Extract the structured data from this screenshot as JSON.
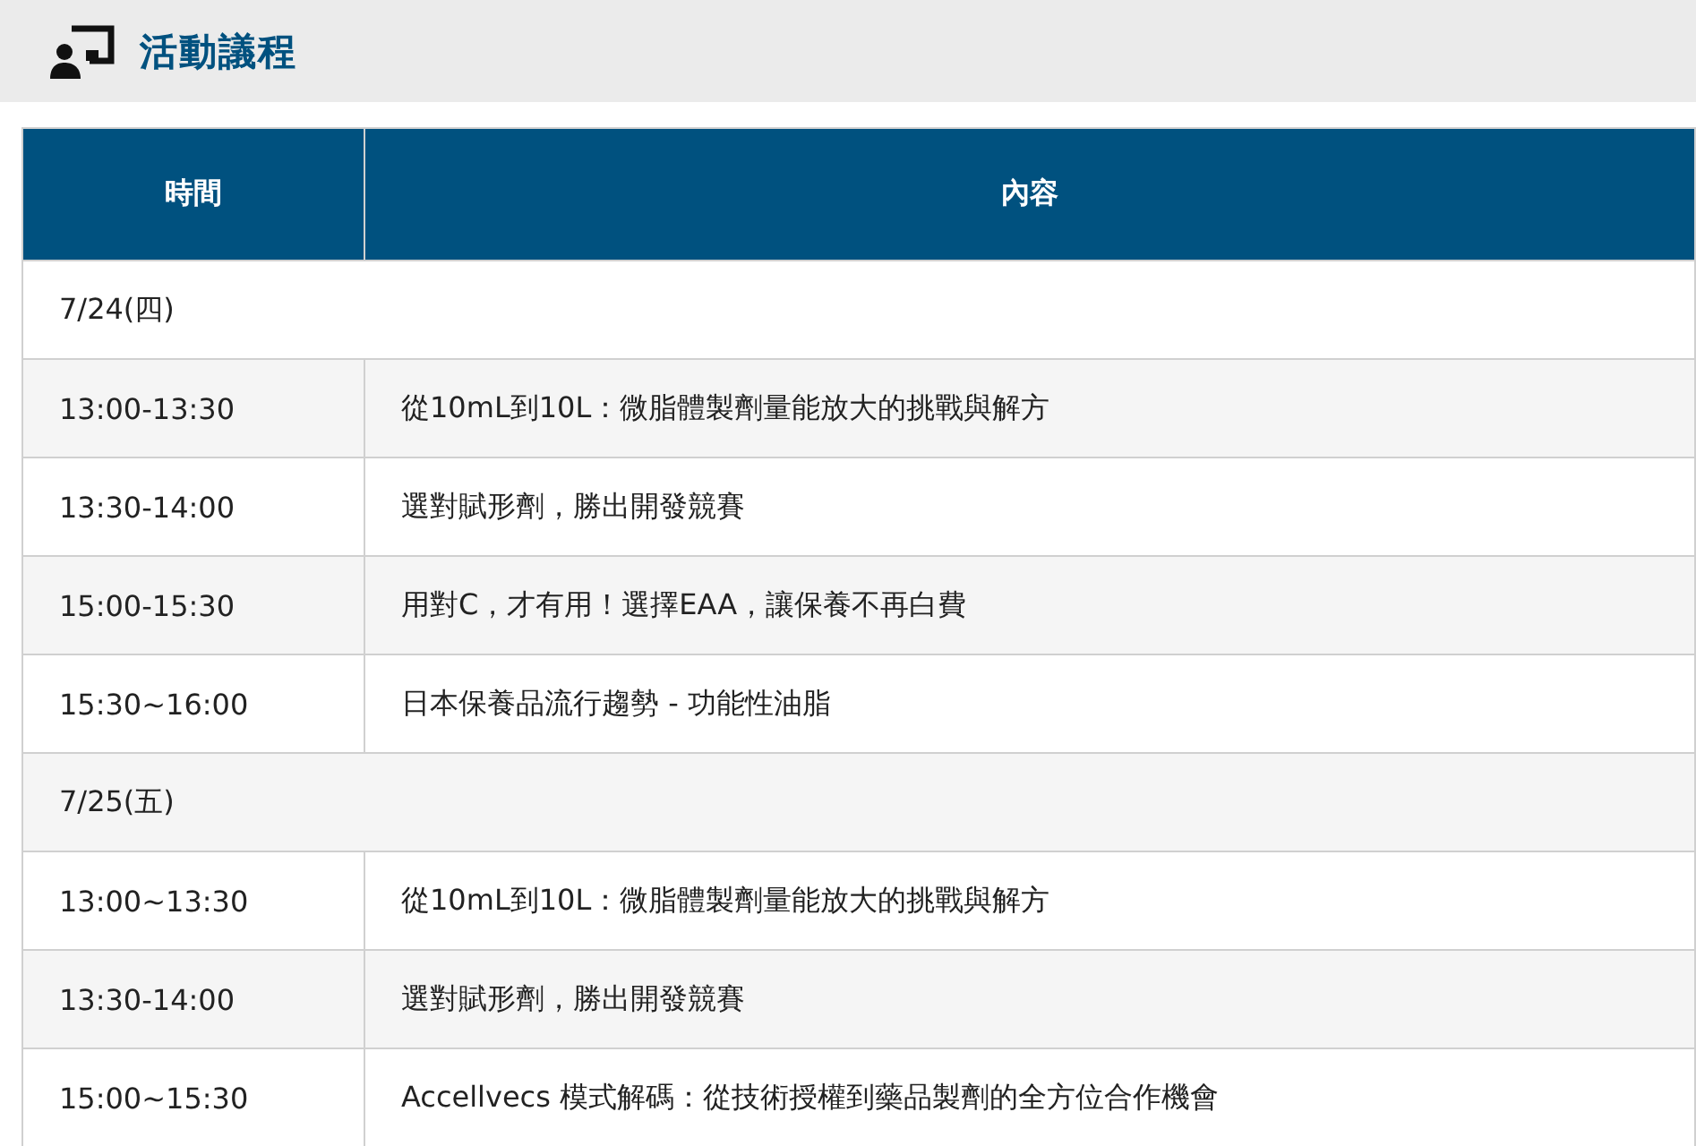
{
  "header": {
    "title": "活動議程"
  },
  "table": {
    "columns": [
      "時間",
      "內容"
    ],
    "rows": [
      {
        "kind": "date",
        "date": "7/24(四)"
      },
      {
        "kind": "session",
        "time": "13:00-13:30",
        "topic": "從10mL到10L：微脂體製劑量能放大的挑戰與解方"
      },
      {
        "kind": "session",
        "time": "13:30-14:00",
        "topic": "選對賦形劑，勝出開發競賽"
      },
      {
        "kind": "session",
        "time": "15:00-15:30",
        "topic": "用對C，才有用！選擇EAA，讓保養不再白費"
      },
      {
        "kind": "session",
        "time": "15:30~16:00",
        "topic": "日本保養品流行趨勢 - 功能性油脂"
      },
      {
        "kind": "date",
        "date": "7/25(五)"
      },
      {
        "kind": "session",
        "time": "13:00~13:30",
        "topic": "從10mL到10L：微脂體製劑量能放大的挑戰與解方"
      },
      {
        "kind": "session",
        "time": "13:30-14:00",
        "topic": "選對賦形劑，勝出開發競賽"
      },
      {
        "kind": "session",
        "time": "15:00~15:30",
        "topic": "Accellvecs 模式解碼：從技術授權到藥品製劑的全方位合作機會"
      }
    ]
  }
}
